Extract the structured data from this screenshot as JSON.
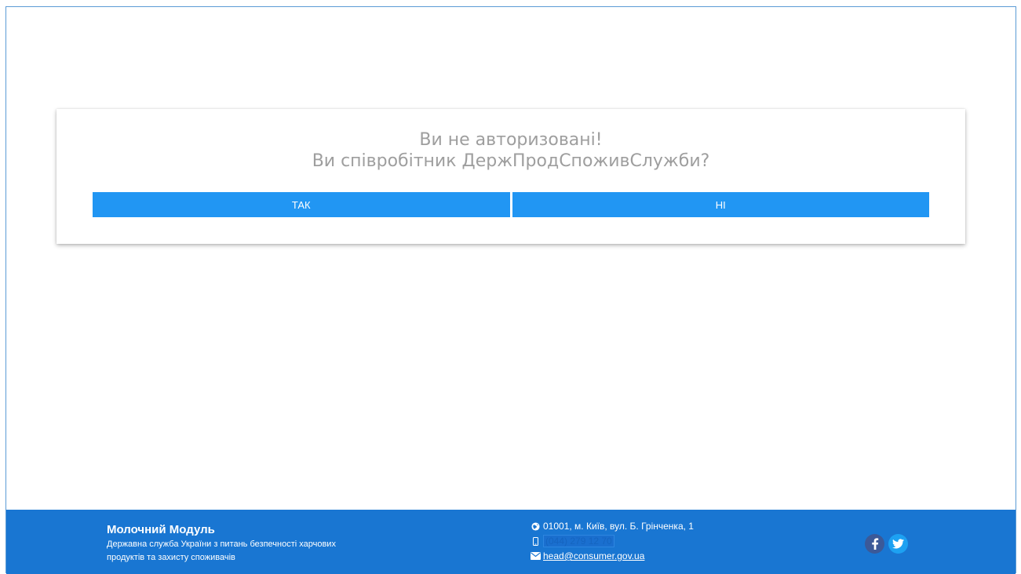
{
  "auth_dialog": {
    "title_line1": "Ви не авторизовані!",
    "title_line2": "Ви співробітник ДержПродСпоживСлужби?",
    "yes_label": "ТАК",
    "no_label": "НІ",
    "button_color": "#2196f3",
    "title_color": "#9e9e9e"
  },
  "footer": {
    "title": "Молочний Модуль",
    "subtitle": "Державна служба України з питань безпечності харчових продуктів та захисту споживачів",
    "address": "01001, м. Київ, вул. Б. Грінченка, 1",
    "phone": "(044) 279 12 70",
    "email": "head@consumer.gov.ua",
    "background_color": "#1976d2",
    "social": [
      {
        "name": "facebook-icon",
        "color": "#3b5998"
      },
      {
        "name": "twitter-icon",
        "color": "#1da1f2"
      }
    ]
  }
}
